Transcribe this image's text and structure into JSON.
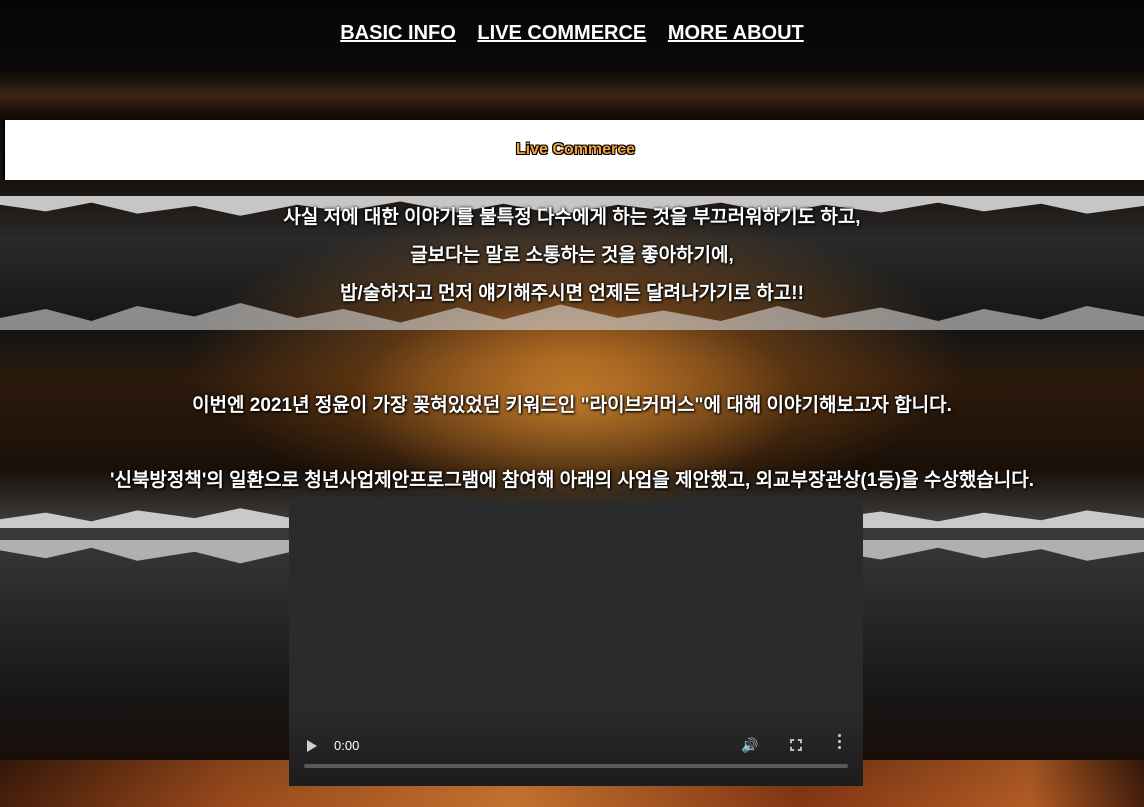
{
  "nav": {
    "items": [
      "BASIC INFO",
      "LIVE COMMERCE",
      "MORE ABOUT"
    ]
  },
  "section": {
    "title": "Live Commerce"
  },
  "intro": {
    "lines": [
      "사실 저에 대한 이야기를 불특정 다수에게 하는 것을 부끄러워하기도 하고,",
      "글보다는 말로 소통하는 것을 좋아하기에,",
      "밥/술하자고 먼저 얘기해주시면 언제든 달려나가기로 하고!!"
    ]
  },
  "body": {
    "keyword_line": "이번엔 2021년 정윤이 가장 꽂혀있었던 키워드인 \"라이브커머스\"에 대해 이야기해보고자 합니다.",
    "award_line": "'신북방정책'의 일환으로 청년사업제안프로그램에 참여해 아래의 사업을 제안했고, 외교부장관상(1등)을 수상했습니다."
  },
  "video": {
    "time": "0:00",
    "icons": [
      "play-icon",
      "volume-icon",
      "fullscreen-icon",
      "more-options-icon"
    ]
  },
  "colors": {
    "title_accent": "#f2a33a",
    "background": "#000000",
    "text": "#ffffff"
  }
}
